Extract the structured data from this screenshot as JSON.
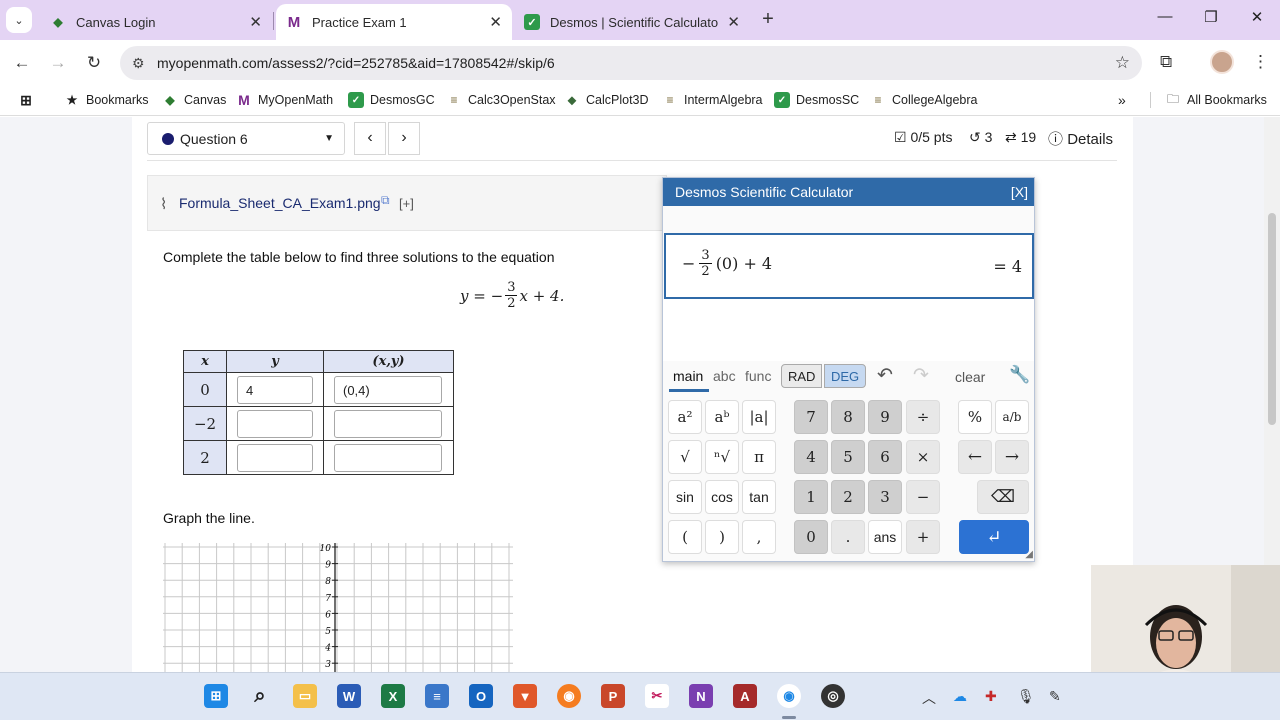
{
  "browser": {
    "tabs": [
      {
        "label": "Canvas Login",
        "active": false
      },
      {
        "label": "Practice Exam 1",
        "active": true
      },
      {
        "label": "Desmos | Scientific Calculator",
        "active": false
      }
    ],
    "url": "myopenmath.com/assess2/?cid=252785&aid=17808542#/skip/6",
    "bookmarks": [
      "Bookmarks",
      "Canvas",
      "MyOpenMath",
      "DesmosGC",
      "Calc3OpenStax",
      "CalcPlot3D",
      "IntermAlgebra",
      "DesmosSC",
      "CollegeAlgebra"
    ],
    "all_bookmarks": "All Bookmarks"
  },
  "question": {
    "selector_label": "Question 6",
    "points": "0/5 pts",
    "retries": "3",
    "attempts": "19",
    "details": "Details",
    "help_file": "Formula_Sheet_CA_Exam1.png",
    "help_plus": "[+]",
    "prompt": "Complete the table below to find three solutions to the equation",
    "equation": {
      "lhs": "y",
      "eq": "=",
      "minus": "−",
      "num": "3",
      "den": "2",
      "rest": "x + 4."
    },
    "table": {
      "headers": [
        "x",
        "y",
        "(x,y)"
      ],
      "rows": [
        {
          "x": "0",
          "y": "4",
          "xy": "(0,4)"
        },
        {
          "x": "−2",
          "y": "",
          "xy": ""
        },
        {
          "x": "2",
          "y": "",
          "xy": ""
        }
      ]
    },
    "graph_prompt": "Graph the line.",
    "graph_y_ticks": [
      "10",
      "9",
      "8",
      "7",
      "6",
      "5",
      "4",
      "3"
    ]
  },
  "desmos": {
    "title": "Desmos Scientific Calculator",
    "close": "[X]",
    "expression": {
      "minus": "−",
      "num": "3",
      "den": "2",
      "rest": "(0) + 4"
    },
    "result": "= 4",
    "tabs": [
      "main",
      "abc",
      "func"
    ],
    "modes": [
      "RAD",
      "DEG"
    ],
    "active_mode": "DEG",
    "clear": "clear",
    "keys": {
      "row1": [
        "a²",
        "aᵇ",
        "|a|",
        "7",
        "8",
        "9",
        "÷",
        "%",
        "a/b"
      ],
      "row2": [
        "√",
        "ⁿ√",
        "π",
        "4",
        "5",
        "6",
        "×",
        "←",
        "→"
      ],
      "row3": [
        "sin",
        "cos",
        "tan",
        "1",
        "2",
        "3",
        "−",
        "⌫"
      ],
      "row4": [
        "(",
        ")",
        ",",
        "0",
        ".",
        "ans",
        "+",
        "↵"
      ]
    }
  },
  "colors": {
    "accent": "#2f6aa8",
    "tabstrip": "#e4d4f4",
    "table_header": "#dfe4f4"
  }
}
